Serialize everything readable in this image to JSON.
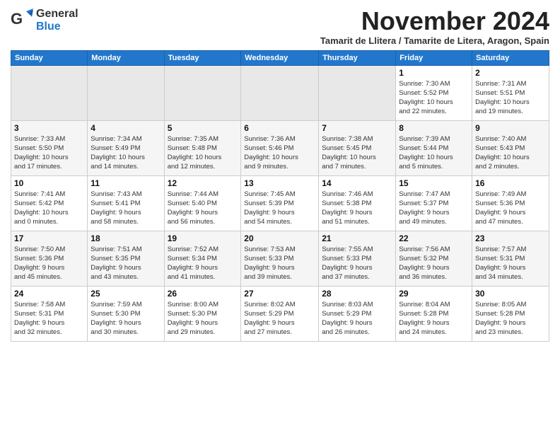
{
  "logo": {
    "text_general": "General",
    "text_blue": "Blue"
  },
  "header": {
    "month_year": "November 2024",
    "subtitle": "Tamarit de Llitera / Tamarite de Litera, Aragon, Spain"
  },
  "days_of_week": [
    "Sunday",
    "Monday",
    "Tuesday",
    "Wednesday",
    "Thursday",
    "Friday",
    "Saturday"
  ],
  "weeks": [
    [
      {
        "day": "",
        "info": ""
      },
      {
        "day": "",
        "info": ""
      },
      {
        "day": "",
        "info": ""
      },
      {
        "day": "",
        "info": ""
      },
      {
        "day": "",
        "info": ""
      },
      {
        "day": "1",
        "info": "Sunrise: 7:30 AM\nSunset: 5:52 PM\nDaylight: 10 hours\nand 22 minutes."
      },
      {
        "day": "2",
        "info": "Sunrise: 7:31 AM\nSunset: 5:51 PM\nDaylight: 10 hours\nand 19 minutes."
      }
    ],
    [
      {
        "day": "3",
        "info": "Sunrise: 7:33 AM\nSunset: 5:50 PM\nDaylight: 10 hours\nand 17 minutes."
      },
      {
        "day": "4",
        "info": "Sunrise: 7:34 AM\nSunset: 5:49 PM\nDaylight: 10 hours\nand 14 minutes."
      },
      {
        "day": "5",
        "info": "Sunrise: 7:35 AM\nSunset: 5:48 PM\nDaylight: 10 hours\nand 12 minutes."
      },
      {
        "day": "6",
        "info": "Sunrise: 7:36 AM\nSunset: 5:46 PM\nDaylight: 10 hours\nand 9 minutes."
      },
      {
        "day": "7",
        "info": "Sunrise: 7:38 AM\nSunset: 5:45 PM\nDaylight: 10 hours\nand 7 minutes."
      },
      {
        "day": "8",
        "info": "Sunrise: 7:39 AM\nSunset: 5:44 PM\nDaylight: 10 hours\nand 5 minutes."
      },
      {
        "day": "9",
        "info": "Sunrise: 7:40 AM\nSunset: 5:43 PM\nDaylight: 10 hours\nand 2 minutes."
      }
    ],
    [
      {
        "day": "10",
        "info": "Sunrise: 7:41 AM\nSunset: 5:42 PM\nDaylight: 10 hours\nand 0 minutes."
      },
      {
        "day": "11",
        "info": "Sunrise: 7:43 AM\nSunset: 5:41 PM\nDaylight: 9 hours\nand 58 minutes."
      },
      {
        "day": "12",
        "info": "Sunrise: 7:44 AM\nSunset: 5:40 PM\nDaylight: 9 hours\nand 56 minutes."
      },
      {
        "day": "13",
        "info": "Sunrise: 7:45 AM\nSunset: 5:39 PM\nDaylight: 9 hours\nand 54 minutes."
      },
      {
        "day": "14",
        "info": "Sunrise: 7:46 AM\nSunset: 5:38 PM\nDaylight: 9 hours\nand 51 minutes."
      },
      {
        "day": "15",
        "info": "Sunrise: 7:47 AM\nSunset: 5:37 PM\nDaylight: 9 hours\nand 49 minutes."
      },
      {
        "day": "16",
        "info": "Sunrise: 7:49 AM\nSunset: 5:36 PM\nDaylight: 9 hours\nand 47 minutes."
      }
    ],
    [
      {
        "day": "17",
        "info": "Sunrise: 7:50 AM\nSunset: 5:36 PM\nDaylight: 9 hours\nand 45 minutes."
      },
      {
        "day": "18",
        "info": "Sunrise: 7:51 AM\nSunset: 5:35 PM\nDaylight: 9 hours\nand 43 minutes."
      },
      {
        "day": "19",
        "info": "Sunrise: 7:52 AM\nSunset: 5:34 PM\nDaylight: 9 hours\nand 41 minutes."
      },
      {
        "day": "20",
        "info": "Sunrise: 7:53 AM\nSunset: 5:33 PM\nDaylight: 9 hours\nand 39 minutes."
      },
      {
        "day": "21",
        "info": "Sunrise: 7:55 AM\nSunset: 5:33 PM\nDaylight: 9 hours\nand 37 minutes."
      },
      {
        "day": "22",
        "info": "Sunrise: 7:56 AM\nSunset: 5:32 PM\nDaylight: 9 hours\nand 36 minutes."
      },
      {
        "day": "23",
        "info": "Sunrise: 7:57 AM\nSunset: 5:31 PM\nDaylight: 9 hours\nand 34 minutes."
      }
    ],
    [
      {
        "day": "24",
        "info": "Sunrise: 7:58 AM\nSunset: 5:31 PM\nDaylight: 9 hours\nand 32 minutes."
      },
      {
        "day": "25",
        "info": "Sunrise: 7:59 AM\nSunset: 5:30 PM\nDaylight: 9 hours\nand 30 minutes."
      },
      {
        "day": "26",
        "info": "Sunrise: 8:00 AM\nSunset: 5:30 PM\nDaylight: 9 hours\nand 29 minutes."
      },
      {
        "day": "27",
        "info": "Sunrise: 8:02 AM\nSunset: 5:29 PM\nDaylight: 9 hours\nand 27 minutes."
      },
      {
        "day": "28",
        "info": "Sunrise: 8:03 AM\nSunset: 5:29 PM\nDaylight: 9 hours\nand 26 minutes."
      },
      {
        "day": "29",
        "info": "Sunrise: 8:04 AM\nSunset: 5:28 PM\nDaylight: 9 hours\nand 24 minutes."
      },
      {
        "day": "30",
        "info": "Sunrise: 8:05 AM\nSunset: 5:28 PM\nDaylight: 9 hours\nand 23 minutes."
      }
    ]
  ]
}
